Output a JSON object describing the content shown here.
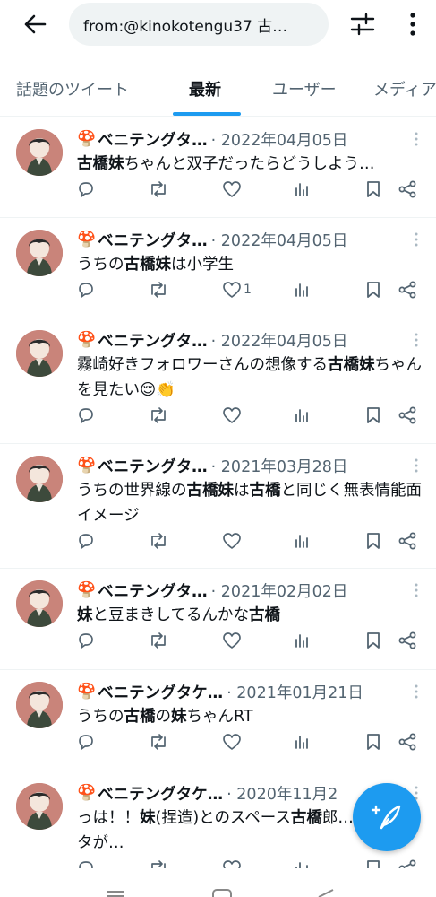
{
  "header": {
    "search_value": "from:@kinokotengu37 古…",
    "back_icon": "arrow-left-icon",
    "filter_icon": "sliders-icon",
    "more_icon": "more-vertical-icon"
  },
  "tabs": [
    {
      "label": "話題のツイート"
    },
    {
      "label": "最新"
    },
    {
      "label": "ユーザー"
    },
    {
      "label": "メディア"
    }
  ],
  "colors": {
    "accent": "#1d9bf0",
    "secondary_text": "#536471",
    "divider": "#eff3f4"
  },
  "tweets": [
    {
      "mushroom": "🍄",
      "name": "ベニテングタ…",
      "date": "· 2022年04月05日",
      "segments": [
        {
          "t": "古橋妹",
          "b": true
        },
        {
          "t": "ちゃんと双子だったらどうしよう…",
          "b": false
        }
      ],
      "like_count": ""
    },
    {
      "mushroom": "🍄",
      "name": "ベニテングタ…",
      "date": "· 2022年04月05日",
      "segments": [
        {
          "t": "うちの",
          "b": false
        },
        {
          "t": "古橋妹",
          "b": true
        },
        {
          "t": "は小学生",
          "b": false
        }
      ],
      "like_count": "1"
    },
    {
      "mushroom": "🍄",
      "name": "ベニテングタ…",
      "date": "· 2022年04月05日",
      "segments": [
        {
          "t": "霧崎好きフォロワーさんの想像する",
          "b": false
        },
        {
          "t": "古橋妹",
          "b": true
        },
        {
          "t": "ちゃんを見たい😌👏",
          "b": false
        }
      ],
      "like_count": ""
    },
    {
      "mushroom": "🍄",
      "name": "ベニテングタ…",
      "date": "· 2021年03月28日",
      "segments": [
        {
          "t": "うちの世界線の",
          "b": false
        },
        {
          "t": "古橋妹",
          "b": true
        },
        {
          "t": "は",
          "b": false
        },
        {
          "t": "古橋",
          "b": true
        },
        {
          "t": "と同じく無表情能面イメージ",
          "b": false
        }
      ],
      "like_count": ""
    },
    {
      "mushroom": "🍄",
      "name": "ベニテングタ…",
      "date": "· 2021年02月02日",
      "segments": [
        {
          "t": "妹",
          "b": true
        },
        {
          "t": "と豆まきしてるんかな",
          "b": false
        },
        {
          "t": "古橋",
          "b": true
        }
      ],
      "like_count": ""
    },
    {
      "mushroom": "🍄",
      "name": "ベニテングタケ…",
      "date": "· 2021年01月21日",
      "segments": [
        {
          "t": "うちの",
          "b": false
        },
        {
          "t": "古橋",
          "b": true
        },
        {
          "t": "の",
          "b": false
        },
        {
          "t": "妹",
          "b": true
        },
        {
          "t": "ちゃんRT",
          "b": false
        }
      ],
      "like_count": ""
    },
    {
      "mushroom": "🍄",
      "name": "ベニテングタケ…",
      "date": "· 2020年11月2",
      "segments": [
        {
          "t": "っは！！",
          "b": false
        },
        {
          "t": "妹",
          "b": true
        },
        {
          "t": "(捏造)とのスペース",
          "b": false
        },
        {
          "t": "古橋",
          "b": true
        },
        {
          "t": "郎…新たなネタが…",
          "b": false
        }
      ],
      "like_count": ""
    }
  ],
  "action_icons": [
    "reply-icon",
    "retweet-icon",
    "like-icon",
    "views-icon",
    "bookmark-icon",
    "share-icon"
  ],
  "fab": {
    "icon": "compose-feather-icon"
  }
}
